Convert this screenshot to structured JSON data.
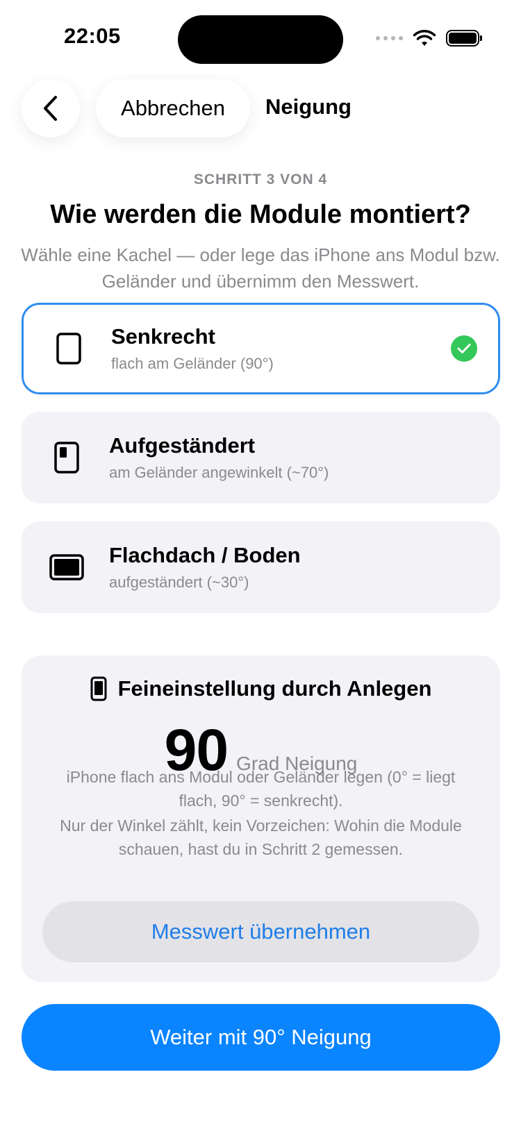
{
  "status_bar": {
    "time": "22:05"
  },
  "nav": {
    "cancel_label": "Abbrechen",
    "title": "Neigung"
  },
  "step_label": "SCHRITT 3 VON 4",
  "headline": "Wie werden die Module montiert?",
  "subline": "Wähle eine Kachel — oder lege das iPhone ans Modul bzw. Geländer und übernimm den Messwert.",
  "options": [
    {
      "title": "Senkrecht",
      "subtitle": "flach am Geländer (90°)",
      "selected": true,
      "icon": "portrait-rect-icon"
    },
    {
      "title": "Aufgeständert",
      "subtitle": "am Geländer angewinkelt (~70°)",
      "selected": false,
      "icon": "tilted-panel-icon"
    },
    {
      "title": "Flachdach / Boden",
      "subtitle": "aufgeständert (~30°)",
      "selected": false,
      "icon": "landscape-rect-icon"
    }
  ],
  "fine_tune": {
    "title": "Feineinstellung durch Anlegen",
    "value": "90",
    "unit": "Grad Neigung",
    "hint_1": "iPhone flach ans Modul oder Geländer legen (0° = liegt flach, 90° = senkrecht).",
    "hint_2": "Nur der Winkel zählt, kein Vorzeichen: Wohin die Module schauen, hast du in Schritt 2 gemessen.",
    "apply_label": "Messwert übernehmen"
  },
  "primary_button": "Weiter mit 90° Neigung",
  "colors": {
    "accent": "#0a84ff",
    "check": "#34c759",
    "card_bg": "#f2f2f7",
    "selected_border": "#2f8cf0"
  }
}
